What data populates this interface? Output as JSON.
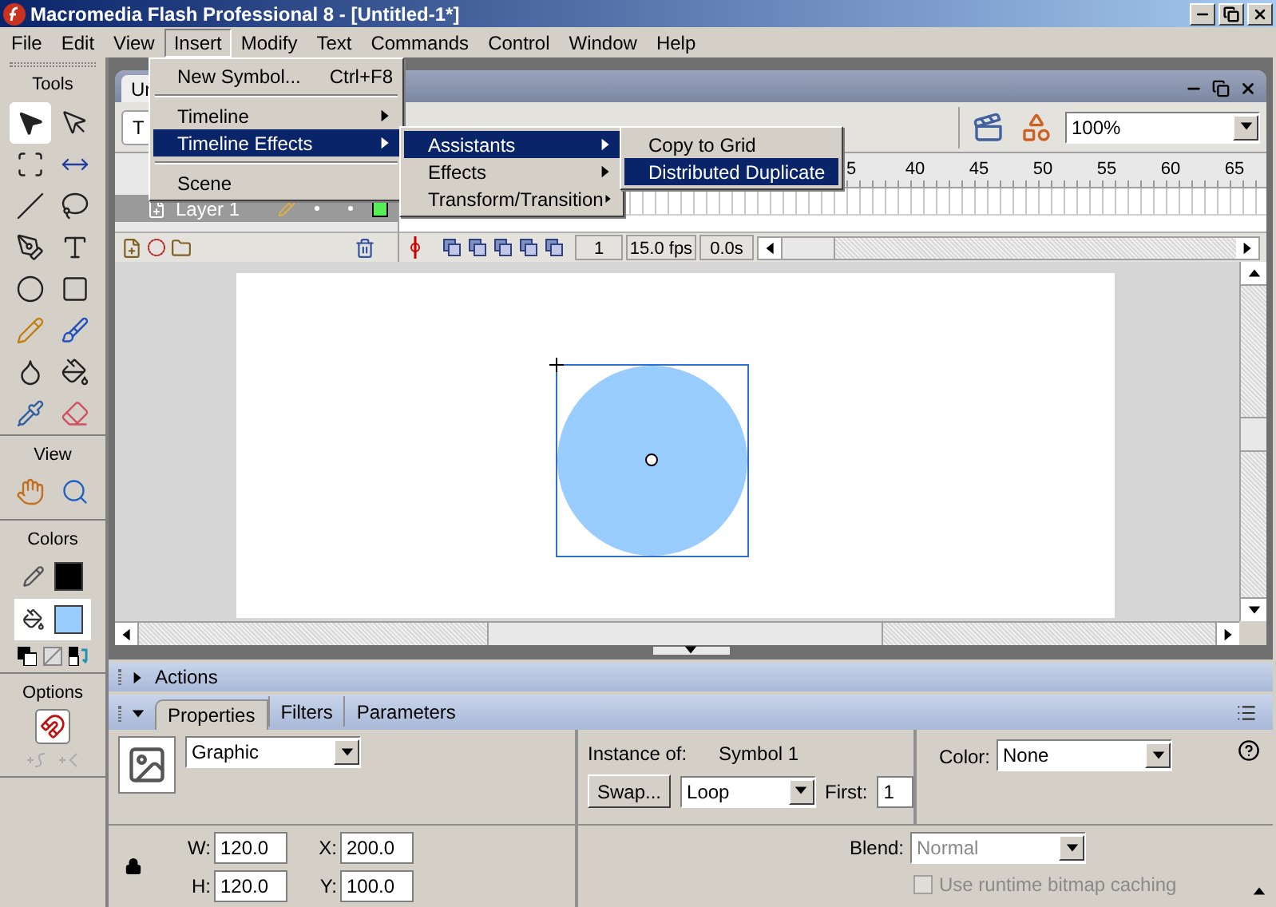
{
  "window": {
    "title": "Macromedia Flash Professional 8 - [Untitled-1*]"
  },
  "menu_bar": [
    {
      "label": "File",
      "selected": false
    },
    {
      "label": "Edit",
      "selected": false
    },
    {
      "label": "View",
      "selected": false
    },
    {
      "label": "Insert",
      "selected": true
    },
    {
      "label": "Modify",
      "selected": false
    },
    {
      "label": "Text",
      "selected": false
    },
    {
      "label": "Commands",
      "selected": false
    },
    {
      "label": "Control",
      "selected": false
    },
    {
      "label": "Window",
      "selected": false
    },
    {
      "label": "Help",
      "selected": false
    }
  ],
  "insert_menu": [
    {
      "kind": "item",
      "label": "New Symbol...",
      "shortcut": "Ctrl+F8",
      "selected": false
    },
    {
      "kind": "separator"
    },
    {
      "kind": "submenu",
      "label": "Timeline",
      "selected": false
    },
    {
      "kind": "submenu",
      "label": "Timeline Effects",
      "selected": true
    },
    {
      "kind": "separator"
    },
    {
      "kind": "item",
      "label": "Scene",
      "selected": false
    }
  ],
  "timeline_effects_menu": [
    {
      "label": "Assistants",
      "selected": true
    },
    {
      "label": "Effects",
      "selected": false
    },
    {
      "label": "Transform/Transition",
      "selected": false
    }
  ],
  "assistants_menu": [
    {
      "label": "Copy to Grid",
      "selected": false
    },
    {
      "label": "Distributed Duplicate",
      "selected": true
    }
  ],
  "tools": {
    "title": "Tools",
    "view_title": "View",
    "colors_title": "Colors",
    "options_title": "Options"
  },
  "document": {
    "tab": "Ur",
    "scene": "T",
    "zoom": "100%"
  },
  "timeline": {
    "ruler": [
      "5",
      "40",
      "45",
      "50",
      "55",
      "60",
      "65"
    ],
    "layers": [
      {
        "name": "Layer 1",
        "selected": true,
        "color": "#55ee55"
      }
    ],
    "current_frame": "1",
    "frame_rate": "15.0 fps",
    "elapsed": "0.0s"
  },
  "panels": [
    {
      "title": "Actions",
      "expanded": false
    }
  ],
  "properties": {
    "expanded": true,
    "tabs": [
      {
        "label": "Properties",
        "selected": true
      },
      {
        "label": "Filters",
        "selected": false
      },
      {
        "label": "Parameters",
        "selected": false
      }
    ],
    "symbol_type": "Graphic",
    "instance_label": "Instance of:",
    "instance_name": "Symbol 1",
    "swap_button": "Swap...",
    "loop": "Loop",
    "first_label": "First:",
    "first": "1",
    "color_label": "Color:",
    "color_effect": "None",
    "fields": [
      {
        "label": "W:",
        "value": "120.0"
      },
      {
        "label": "X:",
        "value": "200.0"
      },
      {
        "label": "H:",
        "value": "120.0"
      },
      {
        "label": "Y:",
        "value": "100.0"
      }
    ],
    "blend_label": "Blend:",
    "blend": "Normal",
    "blend_disabled": true,
    "cache_label": "Use runtime bitmap caching",
    "cache_checked": false,
    "cache_disabled": true
  }
}
